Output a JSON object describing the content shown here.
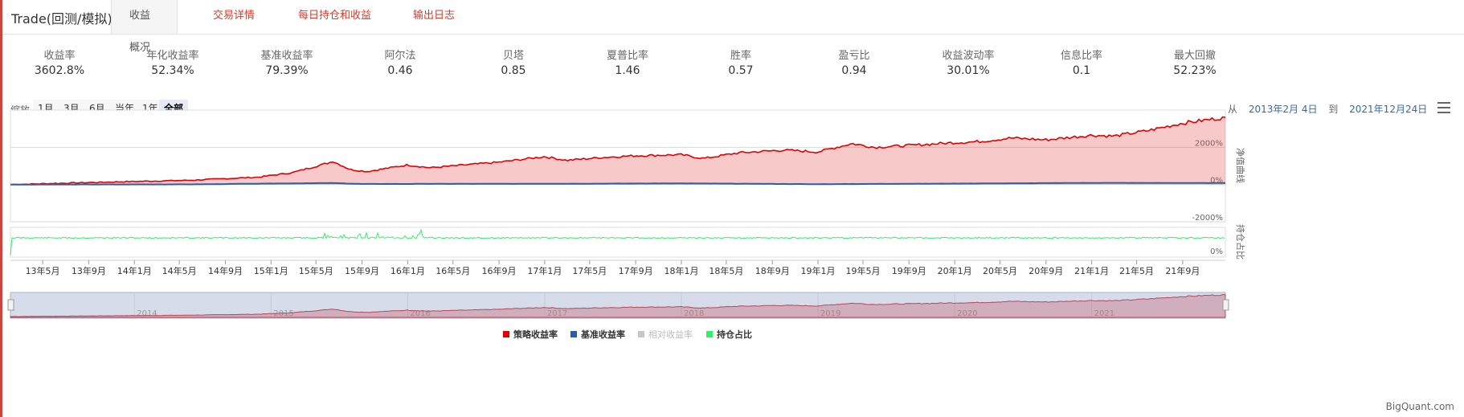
{
  "header": {
    "title": "Trade(回测/模拟)",
    "tabs": [
      {
        "label": "收益概况",
        "active": true
      },
      {
        "label": "交易详情",
        "active": false
      },
      {
        "label": "每日持仓和收益",
        "active": false
      },
      {
        "label": "输出日志",
        "active": false
      }
    ]
  },
  "metrics": [
    {
      "label": "收益率",
      "value": "3602.8%"
    },
    {
      "label": "年化收益率",
      "value": "52.34%"
    },
    {
      "label": "基准收益率",
      "value": "79.39%"
    },
    {
      "label": "阿尔法",
      "value": "0.46"
    },
    {
      "label": "贝塔",
      "value": "0.85"
    },
    {
      "label": "夏普比率",
      "value": "1.46"
    },
    {
      "label": "胜率",
      "value": "0.57"
    },
    {
      "label": "盈亏比",
      "value": "0.94"
    },
    {
      "label": "收益波动率",
      "value": "30.01%"
    },
    {
      "label": "信息比率",
      "value": "0.1"
    },
    {
      "label": "最大回撤",
      "value": "52.23%"
    }
  ],
  "zoom": {
    "label": "缩放",
    "buttons": [
      "1月",
      "3月",
      "6月",
      "当年",
      "1年",
      "全部"
    ],
    "active": "全部"
  },
  "range": {
    "from_label": "从",
    "from": "2013年2月 4日",
    "to_label": "到",
    "to": "2021年12月24日"
  },
  "icons": {
    "menu": "menu-icon"
  },
  "colors": {
    "strategy": "#e00000",
    "benchmark": "#2a5ea8",
    "relative": "#c8c8c8",
    "position": "#33ee66",
    "tab_link": "#d63a2a"
  },
  "chart_data": {
    "type": "area",
    "panes": [
      {
        "name": "净值曲线",
        "y_ticks": [
          "2000%",
          "0%",
          "-2000%"
        ],
        "ylim": [
          -2000,
          4000
        ]
      },
      {
        "name": "持仓占比",
        "y_ticks": [
          "0%"
        ]
      }
    ],
    "x_tick_labels": [
      "13年5月",
      "13年9月",
      "14年1月",
      "14年5月",
      "14年9月",
      "15年1月",
      "15年5月",
      "15年9月",
      "16年1月",
      "16年5月",
      "16年9月",
      "17年1月",
      "17年5月",
      "17年9月",
      "18年1月",
      "18年5月",
      "18年9月",
      "19年1月",
      "19年5月",
      "19年9月",
      "20年1月",
      "20年5月",
      "20年9月",
      "21年1月",
      "21年5月",
      "21年9月"
    ],
    "x_range": [
      "2013-02-04",
      "2021-12-24"
    ],
    "series": [
      {
        "name": "策略收益率",
        "x": [
          "2013-02-04",
          "2013-06-01",
          "2013-12-01",
          "2014-06-01",
          "2014-12-01",
          "2015-03-01",
          "2015-06-01",
          "2015-06-15",
          "2015-08-01",
          "2015-09-15",
          "2015-12-31",
          "2016-03-01",
          "2016-06-01",
          "2016-09-01",
          "2016-12-31",
          "2017-03-01",
          "2017-06-01",
          "2017-09-01",
          "2017-12-31",
          "2018-03-01",
          "2018-06-01",
          "2018-10-01",
          "2018-12-31",
          "2019-04-01",
          "2019-06-01",
          "2019-09-01",
          "2019-12-31",
          "2020-03-01",
          "2020-06-01",
          "2020-09-01",
          "2020-12-31",
          "2021-03-01",
          "2021-06-01",
          "2021-09-01",
          "2021-12-24"
        ],
        "values": [
          0,
          60,
          150,
          230,
          400,
          650,
          1150,
          1250,
          800,
          700,
          1050,
          900,
          1050,
          1200,
          1500,
          1300,
          1450,
          1550,
          1600,
          1400,
          1700,
          1850,
          1750,
          2200,
          2000,
          2100,
          2250,
          2300,
          2500,
          2400,
          2650,
          2600,
          2900,
          3300,
          3602.8
        ]
      },
      {
        "name": "基准收益率",
        "x": [
          "2013-02-04",
          "2014-06-01",
          "2015-06-12",
          "2015-09-01",
          "2016-12-31",
          "2018-01-01",
          "2019-01-01",
          "2020-01-01",
          "2021-02-01",
          "2021-12-24"
        ],
        "values": [
          0,
          10,
          80,
          30,
          40,
          60,
          20,
          50,
          90,
          79.39
        ]
      },
      {
        "name": "相对收益率",
        "hidden": true
      },
      {
        "name": "持仓占比"
      }
    ],
    "navigator": {
      "year_labels": [
        "2014",
        "2015",
        "2016",
        "2017",
        "2018",
        "2019",
        "2020",
        "2021"
      ]
    },
    "legend_position": "bottom-center"
  },
  "footer": {
    "brand": "BigQuant.com"
  }
}
